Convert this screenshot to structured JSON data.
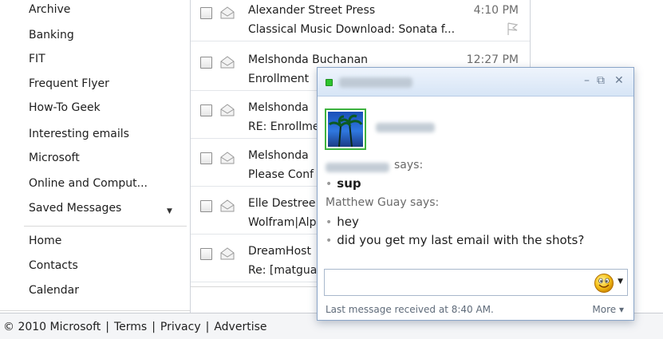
{
  "folders": {
    "items": [
      {
        "label": "Archive"
      },
      {
        "label": "Banking"
      },
      {
        "label": "FIT"
      },
      {
        "label": "Frequent Flyer"
      },
      {
        "label": "How-To Geek"
      },
      {
        "label": "Interesting emails"
      },
      {
        "label": "Microsoft"
      },
      {
        "label": "Online and Comput..."
      },
      {
        "label": "Saved Messages"
      }
    ],
    "nav": [
      {
        "label": "Home"
      },
      {
        "label": "Contacts"
      },
      {
        "label": "Calendar"
      }
    ]
  },
  "messages": [
    {
      "sender": "Alexander Street Press",
      "subject": "Classical Music Download: Sonata f...",
      "time": "4:10 PM"
    },
    {
      "sender": "Melshonda Buchanan",
      "subject": "Enrollment",
      "time": "12:27 PM"
    },
    {
      "sender": "Melshonda",
      "subject": "RE: Enrollme",
      "time": ""
    },
    {
      "sender": "Melshonda",
      "subject": "Please Conf",
      "time": ""
    },
    {
      "sender": "Elle Destree",
      "subject": "Wolfram|Alp",
      "time": ""
    },
    {
      "sender": "DreamHost",
      "subject": "Re: [matgua",
      "time": ""
    }
  ],
  "footer": {
    "copyright": "© 2010 Microsoft",
    "terms": "Terms",
    "privacy": "Privacy",
    "advertise": "Advertise"
  },
  "chat": {
    "controls": {
      "minimize": "–",
      "popout": "⧉",
      "close": "✕"
    },
    "says_label": "says:",
    "contact_message": "sup",
    "self_name_line": "Matthew Guay says:",
    "self_messages": [
      "hey",
      "did you get my last email with the shots?"
    ],
    "input": {
      "value": "",
      "placeholder": ""
    },
    "status": "Last message received at 8:40 AM.",
    "more": "More",
    "more_caret": "▾",
    "emoticon_caret": "▼"
  },
  "icons": {
    "status": "status-online-icon",
    "emoticon": "smiley-emoticon-icon",
    "envelope": "envelope-icon",
    "flag": "flag-icon"
  },
  "colors": {
    "online": "#2ec42e",
    "titlebar": "#d7e5f6",
    "chat_border": "#8aa5c8"
  }
}
